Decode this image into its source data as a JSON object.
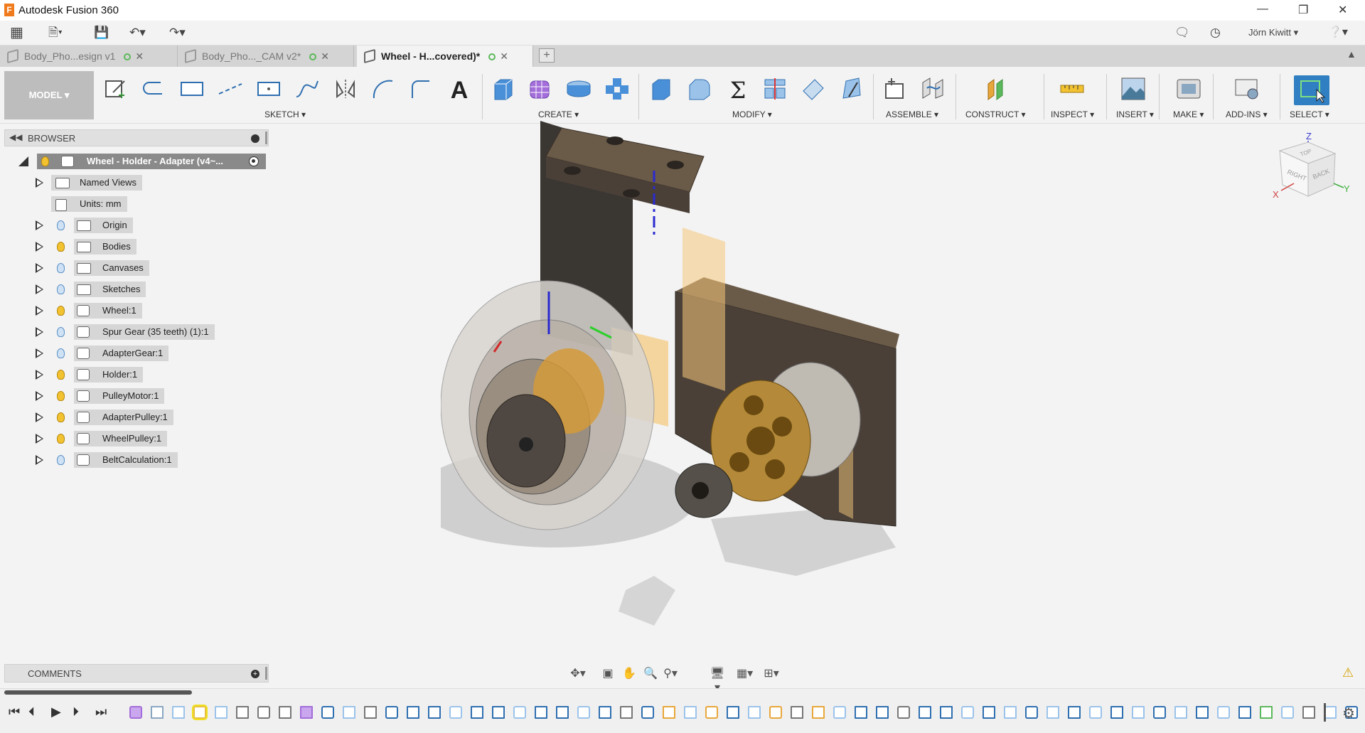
{
  "window": {
    "title": "Autodesk Fusion 360"
  },
  "quickbar": {
    "user": "Jörn Kiwitt"
  },
  "tabs": [
    {
      "label": "Body_Pho...esign v1"
    },
    {
      "label": "Body_Pho..._CAM v2*"
    },
    {
      "label": "Wheel - H...covered)*"
    }
  ],
  "ribbon": {
    "workspace": "MODEL",
    "groups": {
      "sketch": "SKETCH",
      "create": "CREATE",
      "modify": "MODIFY",
      "assemble": "ASSEMBLE",
      "construct": "CONSTRUCT",
      "inspect": "INSPECT",
      "insert": "INSERT",
      "make": "MAKE",
      "addins": "ADD-INS",
      "select": "SELECT"
    }
  },
  "browser": {
    "header": "BROWSER",
    "root": "Wheel - Holder - Adapter (v4~...",
    "items": [
      {
        "label": "Named Views",
        "icon": "folder-icon",
        "bulb": "none"
      },
      {
        "label": "Units: mm",
        "icon": "document-icon",
        "bulb": "none"
      },
      {
        "label": "Origin",
        "icon": "folder-icon",
        "bulb": "off"
      },
      {
        "label": "Bodies",
        "icon": "folder-icon",
        "bulb": "on"
      },
      {
        "label": "Canvases",
        "icon": "folder-icon",
        "bulb": "off"
      },
      {
        "label": "Sketches",
        "icon": "folder-icon",
        "bulb": "off"
      },
      {
        "label": "Wheel:1",
        "icon": "component-icon",
        "bulb": "on"
      },
      {
        "label": "Spur Gear (35 teeth) (1):1",
        "icon": "component-icon",
        "bulb": "off"
      },
      {
        "label": "AdapterGear:1",
        "icon": "component-icon",
        "bulb": "off"
      },
      {
        "label": "Holder:1",
        "icon": "linked-component-icon",
        "bulb": "on"
      },
      {
        "label": "PulleyMotor:1",
        "icon": "linked-component-icon",
        "bulb": "on"
      },
      {
        "label": "AdapterPulley:1",
        "icon": "component-icon",
        "bulb": "on"
      },
      {
        "label": "WheelPulley:1",
        "icon": "linked-component-icon",
        "bulb": "on"
      },
      {
        "label": "BeltCalculation:1",
        "icon": "component-icon",
        "bulb": "off"
      }
    ]
  },
  "comments": {
    "header": "COMMENTS"
  },
  "viewcube": {
    "top": "TOP",
    "right": "RIGHT",
    "back": "BACK",
    "axis_x": "X",
    "axis_y": "Y",
    "axis_z": "Z"
  },
  "colors": {
    "accent": "#2f7fc2",
    "bulb_on": "#f2c230",
    "bulb_off": "#cfe2f5",
    "tab_dot": "#5cb85c"
  }
}
